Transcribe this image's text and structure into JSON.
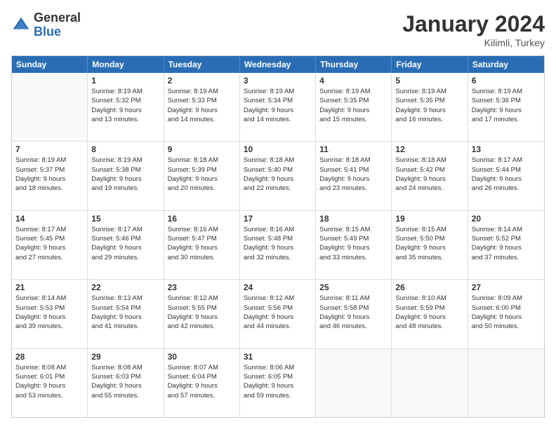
{
  "logo": {
    "general": "General",
    "blue": "Blue"
  },
  "title": "January 2024",
  "subtitle": "Kilimli, Turkey",
  "days": [
    "Sunday",
    "Monday",
    "Tuesday",
    "Wednesday",
    "Thursday",
    "Friday",
    "Saturday"
  ],
  "weeks": [
    [
      {
        "day": "",
        "info": ""
      },
      {
        "day": "1",
        "info": "Sunrise: 8:19 AM\nSunset: 5:32 PM\nDaylight: 9 hours\nand 13 minutes."
      },
      {
        "day": "2",
        "info": "Sunrise: 8:19 AM\nSunset: 5:33 PM\nDaylight: 9 hours\nand 14 minutes."
      },
      {
        "day": "3",
        "info": "Sunrise: 8:19 AM\nSunset: 5:34 PM\nDaylight: 9 hours\nand 14 minutes."
      },
      {
        "day": "4",
        "info": "Sunrise: 8:19 AM\nSunset: 5:35 PM\nDaylight: 9 hours\nand 15 minutes."
      },
      {
        "day": "5",
        "info": "Sunrise: 8:19 AM\nSunset: 5:35 PM\nDaylight: 9 hours\nand 16 minutes."
      },
      {
        "day": "6",
        "info": "Sunrise: 8:19 AM\nSunset: 5:36 PM\nDaylight: 9 hours\nand 17 minutes."
      }
    ],
    [
      {
        "day": "7",
        "info": "Sunrise: 8:19 AM\nSunset: 5:37 PM\nDaylight: 9 hours\nand 18 minutes."
      },
      {
        "day": "8",
        "info": "Sunrise: 8:19 AM\nSunset: 5:38 PM\nDaylight: 9 hours\nand 19 minutes."
      },
      {
        "day": "9",
        "info": "Sunrise: 8:18 AM\nSunset: 5:39 PM\nDaylight: 9 hours\nand 20 minutes."
      },
      {
        "day": "10",
        "info": "Sunrise: 8:18 AM\nSunset: 5:40 PM\nDaylight: 9 hours\nand 22 minutes."
      },
      {
        "day": "11",
        "info": "Sunrise: 8:18 AM\nSunset: 5:41 PM\nDaylight: 9 hours\nand 23 minutes."
      },
      {
        "day": "12",
        "info": "Sunrise: 8:18 AM\nSunset: 5:42 PM\nDaylight: 9 hours\nand 24 minutes."
      },
      {
        "day": "13",
        "info": "Sunrise: 8:17 AM\nSunset: 5:44 PM\nDaylight: 9 hours\nand 26 minutes."
      }
    ],
    [
      {
        "day": "14",
        "info": "Sunrise: 8:17 AM\nSunset: 5:45 PM\nDaylight: 9 hours\nand 27 minutes."
      },
      {
        "day": "15",
        "info": "Sunrise: 8:17 AM\nSunset: 5:46 PM\nDaylight: 9 hours\nand 29 minutes."
      },
      {
        "day": "16",
        "info": "Sunrise: 8:16 AM\nSunset: 5:47 PM\nDaylight: 9 hours\nand 30 minutes."
      },
      {
        "day": "17",
        "info": "Sunrise: 8:16 AM\nSunset: 5:48 PM\nDaylight: 9 hours\nand 32 minutes."
      },
      {
        "day": "18",
        "info": "Sunrise: 8:15 AM\nSunset: 5:49 PM\nDaylight: 9 hours\nand 33 minutes."
      },
      {
        "day": "19",
        "info": "Sunrise: 8:15 AM\nSunset: 5:50 PM\nDaylight: 9 hours\nand 35 minutes."
      },
      {
        "day": "20",
        "info": "Sunrise: 8:14 AM\nSunset: 5:52 PM\nDaylight: 9 hours\nand 37 minutes."
      }
    ],
    [
      {
        "day": "21",
        "info": "Sunrise: 8:14 AM\nSunset: 5:53 PM\nDaylight: 9 hours\nand 39 minutes."
      },
      {
        "day": "22",
        "info": "Sunrise: 8:13 AM\nSunset: 5:54 PM\nDaylight: 9 hours\nand 41 minutes."
      },
      {
        "day": "23",
        "info": "Sunrise: 8:12 AM\nSunset: 5:55 PM\nDaylight: 9 hours\nand 42 minutes."
      },
      {
        "day": "24",
        "info": "Sunrise: 8:12 AM\nSunset: 5:56 PM\nDaylight: 9 hours\nand 44 minutes."
      },
      {
        "day": "25",
        "info": "Sunrise: 8:11 AM\nSunset: 5:58 PM\nDaylight: 9 hours\nand 46 minutes."
      },
      {
        "day": "26",
        "info": "Sunrise: 8:10 AM\nSunset: 5:59 PM\nDaylight: 9 hours\nand 48 minutes."
      },
      {
        "day": "27",
        "info": "Sunrise: 8:09 AM\nSunset: 6:00 PM\nDaylight: 9 hours\nand 50 minutes."
      }
    ],
    [
      {
        "day": "28",
        "info": "Sunrise: 8:08 AM\nSunset: 6:01 PM\nDaylight: 9 hours\nand 53 minutes."
      },
      {
        "day": "29",
        "info": "Sunrise: 8:08 AM\nSunset: 6:03 PM\nDaylight: 9 hours\nand 55 minutes."
      },
      {
        "day": "30",
        "info": "Sunrise: 8:07 AM\nSunset: 6:04 PM\nDaylight: 9 hours\nand 57 minutes."
      },
      {
        "day": "31",
        "info": "Sunrise: 8:06 AM\nSunset: 6:05 PM\nDaylight: 9 hours\nand 59 minutes."
      },
      {
        "day": "",
        "info": ""
      },
      {
        "day": "",
        "info": ""
      },
      {
        "day": "",
        "info": ""
      }
    ]
  ]
}
